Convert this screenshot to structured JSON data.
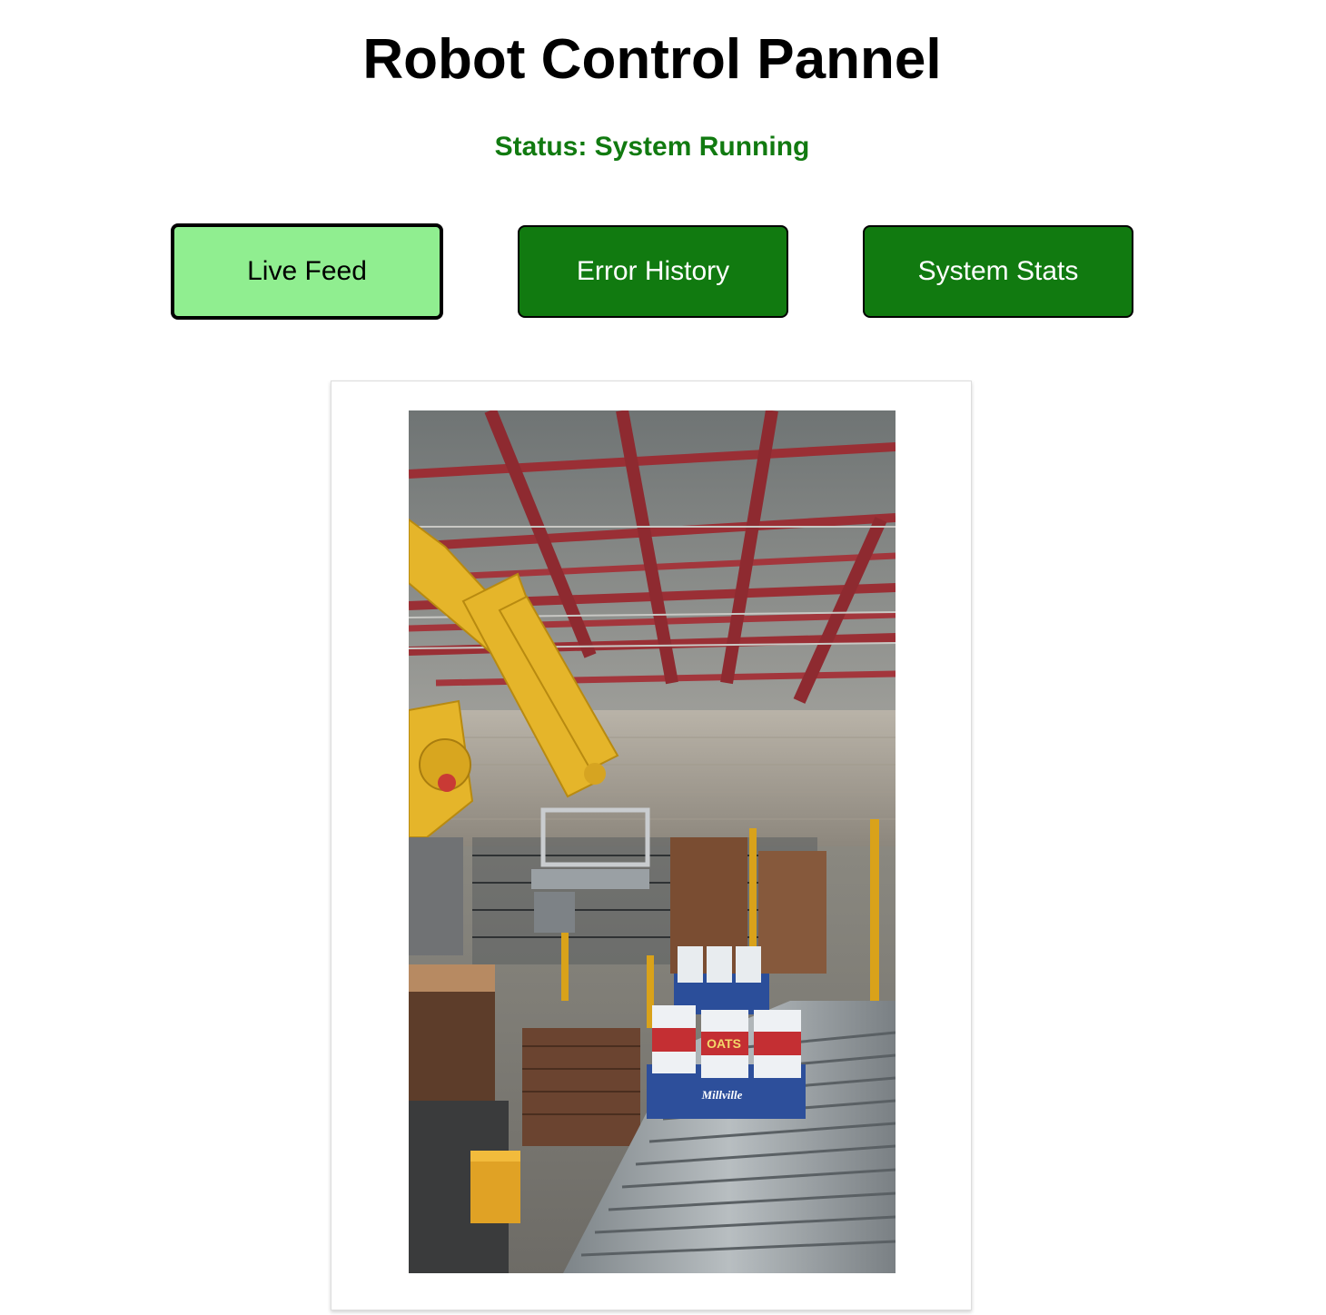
{
  "header": {
    "title": "Robot Control Pannel",
    "status": "Status: System Running"
  },
  "tabs": [
    {
      "label": "Live Feed",
      "active": true
    },
    {
      "label": "Error History",
      "active": false
    },
    {
      "label": "System Stats",
      "active": false
    }
  ],
  "feed": {
    "box_brand": "Millville",
    "can_label": "OATS"
  },
  "colors": {
    "status": "#117a10",
    "tab_bg": "#117a10",
    "tab_active_bg": "#90ee90"
  }
}
